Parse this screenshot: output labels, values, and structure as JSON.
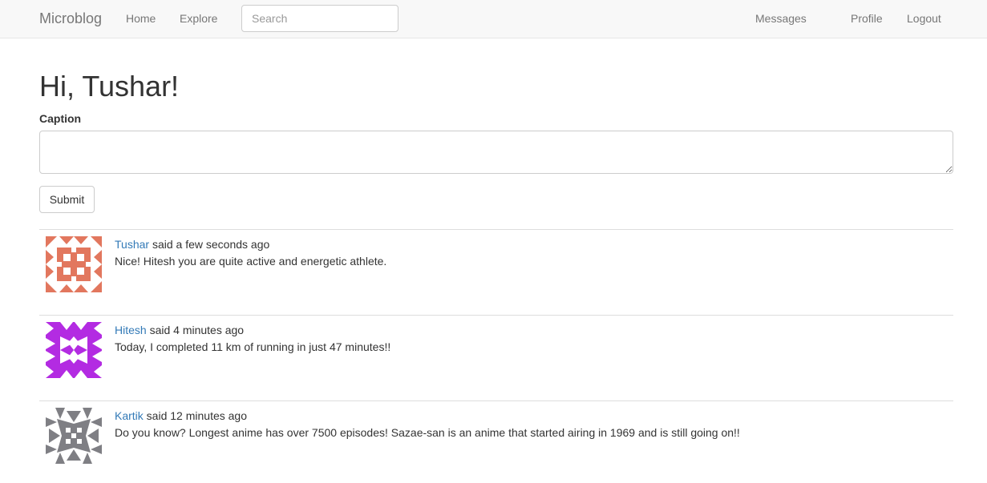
{
  "navbar": {
    "brand": "Microblog",
    "links": [
      "Home",
      "Explore"
    ],
    "search_placeholder": "Search",
    "right_links": [
      "Messages",
      "Profile",
      "Logout"
    ]
  },
  "greeting": "Hi, Tushar!",
  "form": {
    "caption_label": "Caption",
    "caption_value": "",
    "submit_label": "Submit"
  },
  "posts": [
    {
      "username": "Tushar",
      "time_text": " said a few seconds ago",
      "body": "Nice! Hitesh you are quite active and energetic athlete.",
      "avatar_icon": "identicon",
      "avatar_color": "#e2775e"
    },
    {
      "username": "Hitesh",
      "time_text": " said 4 minutes ago",
      "body": "Today, I completed 11 km of running in just 47 minutes!!",
      "avatar_icon": "identicon",
      "avatar_color": "#b32be2"
    },
    {
      "username": "Kartik",
      "time_text": " said 12 minutes ago",
      "body": "Do you know? Longest anime has over 7500 episodes! Sazae-san is an anime that started airing in 1969 and is still going on!!",
      "avatar_icon": "identicon",
      "avatar_color": "#7f7f84"
    }
  ],
  "colors": {
    "link": "#337ab7",
    "navbar_bg": "#f8f8f8",
    "text": "#333333"
  }
}
